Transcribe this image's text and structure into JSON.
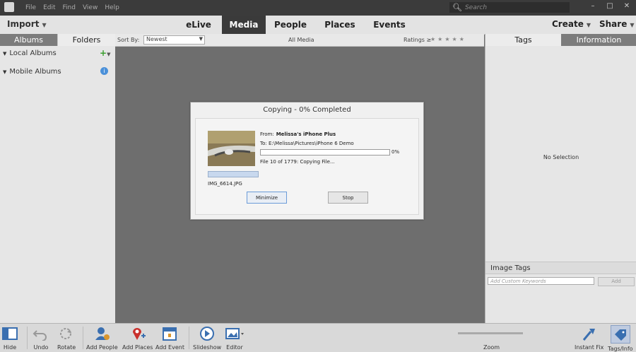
{
  "menu": [
    "File",
    "Edit",
    "Find",
    "View",
    "Help"
  ],
  "search": {
    "placeholder": "Search"
  },
  "nav": {
    "import": "Import",
    "tabs": [
      "eLive",
      "Media",
      "People",
      "Places",
      "Events"
    ],
    "active_tab": "Media",
    "create": "Create",
    "share": "Share"
  },
  "left": {
    "tabs": [
      "Albums",
      "Folders"
    ],
    "items": [
      "Local Albums",
      "Mobile Albums"
    ]
  },
  "sortbar": {
    "label": "Sort By:",
    "value": "Newest",
    "center": "All Media",
    "ratings": "Ratings",
    "ratings_op": "≥"
  },
  "dialog": {
    "title": "Copying - 0% Completed",
    "from_label": "From:",
    "from_value": "Melissa's iPhone Plus",
    "to": "To:  E:\\Melissa\\Pictures\\iPhone 6 Demo",
    "progress_pct": 0,
    "progress_text": "0%",
    "status": "File 10 of 1779: Copying File...",
    "filename": "IMG_6614.JPG",
    "minimize": "Minimize",
    "stop": "Stop"
  },
  "right": {
    "tabs": [
      "Tags",
      "Information"
    ],
    "no_selection": "No Selection",
    "image_tags": "Image Tags",
    "keywords_placeholder": "Add Custom Keywords",
    "add": "Add"
  },
  "toolbar": {
    "hide": "Hide",
    "undo": "Undo",
    "rotate": "Rotate",
    "add_people": "Add People",
    "add_places": "Add Places",
    "add_event": "Add Event",
    "slideshow": "Slideshow",
    "editor": "Editor",
    "zoom": "Zoom",
    "instant_fix": "Instant Fix",
    "tags_info": "Tags/Info"
  }
}
